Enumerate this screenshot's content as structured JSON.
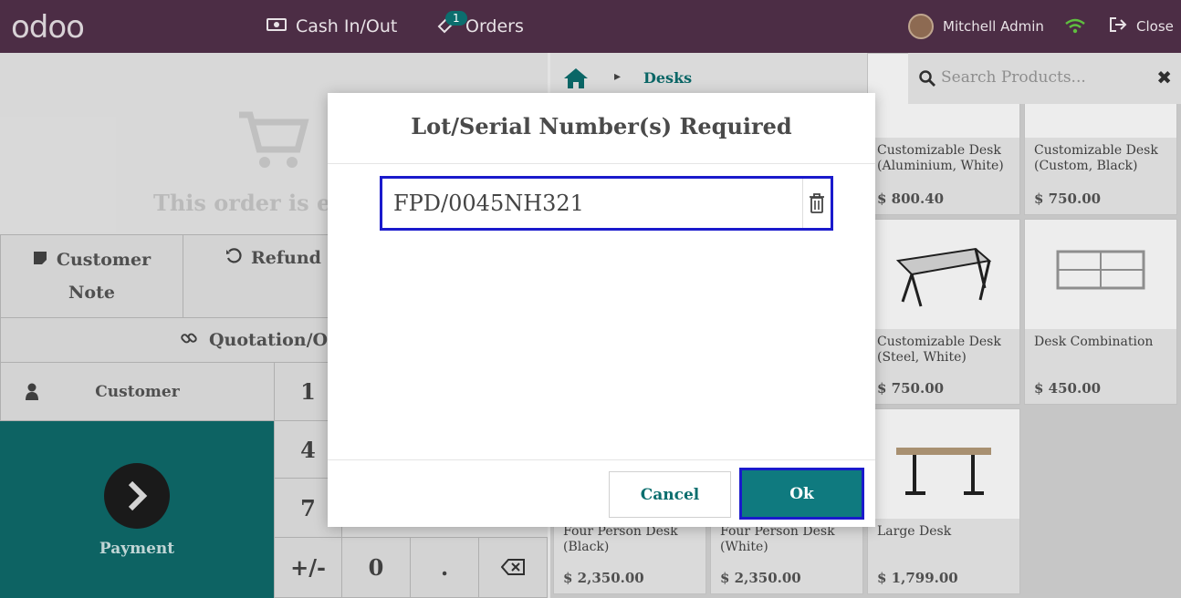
{
  "topbar": {
    "logo": "odoo",
    "cash_label": "Cash In/Out",
    "orders_label": "Orders",
    "orders_badge": "1",
    "user_name": "Mitchell Admin",
    "close_label": "Close"
  },
  "order": {
    "empty_text": "This order is e"
  },
  "actions": {
    "customer_note_line1": "Customer",
    "customer_note_line2": "Note",
    "refund": "Refund",
    "quotation": "Quotation/O",
    "customer": "Customer",
    "payment": "Payment"
  },
  "numpad": {
    "k1": "1",
    "k4": "4",
    "k7": "7",
    "plusminus": "+/-",
    "k0": "0",
    "dot": "."
  },
  "products_panel": {
    "breadcrumb": "Desks",
    "search_placeholder": "Search Products...",
    "products": [
      {
        "name": "Customizable Desk (Aluminium, White)",
        "price": "$ 800.40"
      },
      {
        "name": "Customizable Desk (Custom, Black)",
        "price": "$ 750.00"
      },
      {
        "name": "Customizable Desk (Steel, White)",
        "price": "$ 750.00"
      },
      {
        "name": "Desk Combination",
        "price": "$ 450.00"
      },
      {
        "name": "Four Person Desk (Black)",
        "price": "$ 2,350.00"
      },
      {
        "name": "Four Person Desk (White)",
        "price": "$ 2,350.00"
      },
      {
        "name": "Large Desk",
        "price": "$ 1,799.00"
      }
    ]
  },
  "dialog": {
    "title": "Lot/Serial Number(s) Required",
    "lot_value": "FPD/0045NH321",
    "cancel_label": "Cancel",
    "ok_label": "Ok"
  },
  "colors": {
    "topbar": "#4c2d45",
    "accent": "#0b6e6e",
    "focus_border": "#1a1acc"
  }
}
